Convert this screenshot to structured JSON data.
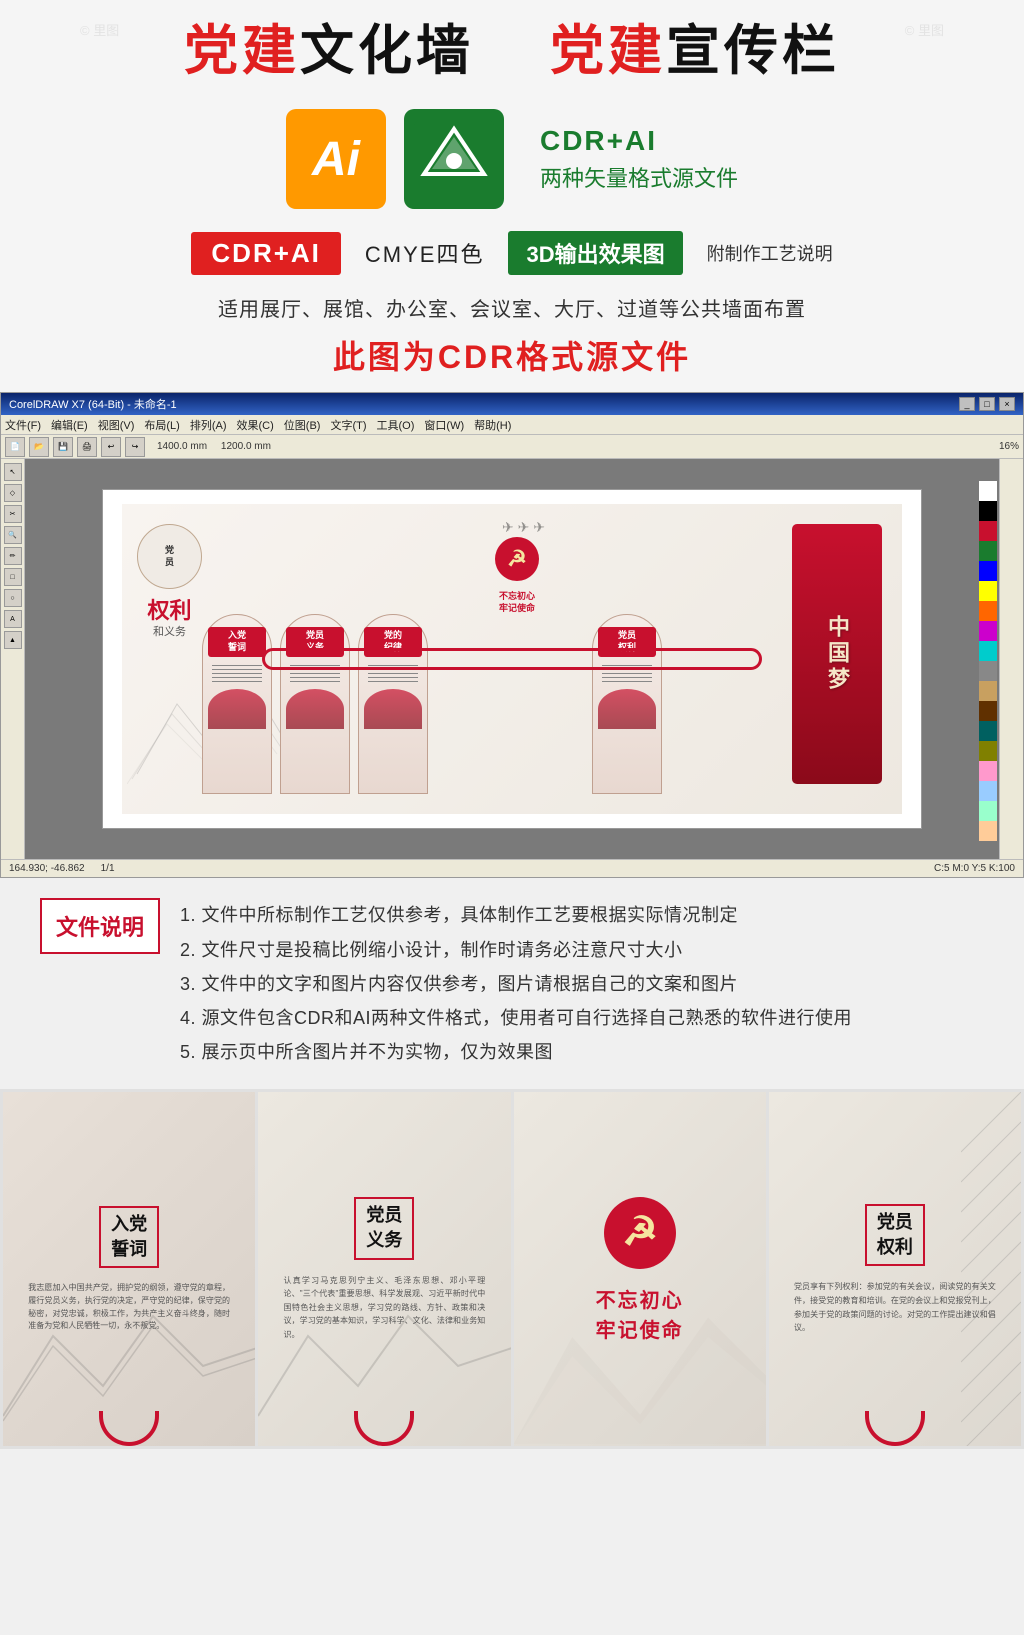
{
  "header": {
    "main_title_part1": "党建",
    "main_title_mid1": "文化墙",
    "main_title_space": "  ",
    "main_title_part2": "党建",
    "main_title_mid2": "宣传栏"
  },
  "icons_section": {
    "ai_label": "Ai",
    "cdr_label": "CDR",
    "format_title": "CDR+AI",
    "format_subtitle": "两种矢量格式源文件"
  },
  "badge_row": {
    "badge1": "CDR+AI",
    "badge2_text": "CMYE四色",
    "badge3": "3D输出效果图",
    "badge4": "附制作工艺说明"
  },
  "subtitle": "适用展厅、展馆、办公室、会议室、大厅、过道等公共墙面布置",
  "cdr_format_title": "此图为CDR格式源文件",
  "corel_window": {
    "title": "CorelDRAW X7 (64-Bit) - 未命名-1",
    "menu_items": [
      "文件(F)",
      "编辑(E)",
      "视图(V)",
      "布局(L)",
      "排列(A)",
      "效果(C)",
      "位图(B)",
      "文字(T)",
      "工具(O)",
      "窗口(W)",
      "帮助(H)"
    ],
    "status": "164.930; -46.862",
    "status2": "1/1",
    "zoom": "16%",
    "dimensions": "1400.0 mm",
    "dim2": "1200.0 mm"
  },
  "design_panels": [
    {
      "title": "入党\n誓词"
    },
    {
      "title": "党员\n义务"
    },
    {
      "title": "党的\n纪律"
    },
    {
      "title": "党员\n权利"
    }
  ],
  "right_panel_text": "中国梦",
  "file_desc": {
    "badge_label": "文件说明",
    "items": [
      "1. 文件中所标制作工艺仅供参考，具体制作工艺要根据实际情况制定",
      "2. 文件尺寸是投稿比例缩小设计，制作时请务必注意尺寸大小",
      "3. 文件中的文字和图片内容仅供参考，图片请根据自己的文案和图片",
      "4. 源文件包含CDR和AI两种文件格式，使用者可自行选择自己熟悉的软件进行使用",
      "5. 展示页中所含图片并不为实物，仅为效果图"
    ]
  },
  "photo_panels": [
    {
      "title": "入党\n誓词"
    },
    {
      "title": "党员\n义务"
    },
    {
      "title": "不忘初心\n牢记使命"
    },
    {
      "title": "党员\n权利"
    }
  ],
  "colors": {
    "red": "#c8102e",
    "green": "#1a7c2e",
    "orange": "#FF9900",
    "dark": "#111111"
  }
}
